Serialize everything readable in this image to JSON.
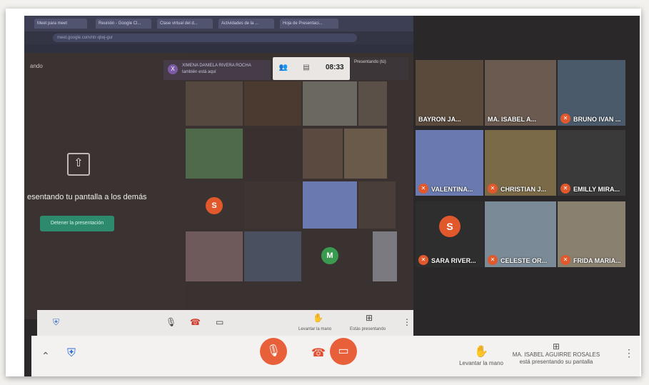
{
  "browser": {
    "tabs": [
      "Meet para meet",
      "Reunión - Google Cl...",
      "Clase virtual del d...",
      "Actividades de la ...",
      "Hoja de Presentaci..."
    ],
    "address": "meet.google.com/ntr-qtwj-gur"
  },
  "meet": {
    "left_top_label": "ando",
    "presenting_text": "esentando tu pantalla a los demás",
    "stop_button": "Detener la presentación",
    "banner_name": "XIMENA DANIELA RIVERA ROCHA",
    "banner_sub": "también está aquí",
    "time": "08:33",
    "presenting_badge": "Presentando (tú)",
    "inner_avatars": [
      "S",
      "M"
    ],
    "inner_bottom": {
      "raise": "Levantar la mano",
      "present": "Estás presentando"
    }
  },
  "participants": [
    {
      "name": "BAYRON JA...",
      "color": "#5a4a3c"
    },
    {
      "name": "MA. ISABEL A...",
      "color": "#6a5a50"
    },
    {
      "name": "BRUNO IVAN ...",
      "color": "#4a5a6a"
    },
    {
      "name": "VALENTINA...",
      "color": "#6a7ab0"
    },
    {
      "name": "CHRISTIAN J...",
      "color": "#7a6a48"
    },
    {
      "name": "EMILLY MIRA...",
      "color": "#3a3a3a"
    },
    {
      "name": "SARA RIVER...",
      "color": "#2e2e2e",
      "avatar": "S"
    },
    {
      "name": "CELESTE OR...",
      "color": "#7a8a96"
    },
    {
      "name": "FRIDA MARIA...",
      "color": "#8a8070"
    }
  ],
  "bottom": {
    "raise_hand": "Levantar la mano",
    "presenter": "MA. ISABEL AGUIRRE ROSALES",
    "presenting": "está presentando su pantalla"
  },
  "colors": {
    "accent_red": "#e8603a",
    "stop_green": "#2e8a6c"
  }
}
